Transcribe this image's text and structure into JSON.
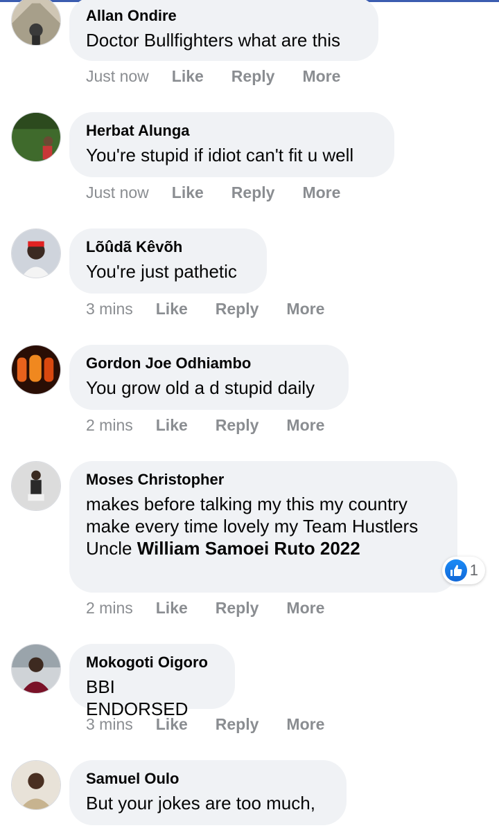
{
  "comments": [
    {
      "author": "Allan Ondire",
      "text": "Doctor Bullfighters what are this",
      "time": "Just now",
      "like": "Like",
      "reply": "Reply",
      "more": "More"
    },
    {
      "author": "Herbat Alunga",
      "text": "You're stupid if idiot can't fit u well",
      "time": "Just now",
      "like": "Like",
      "reply": "Reply",
      "more": "More"
    },
    {
      "author": "Lõûdã Kêvõh",
      "text": "You're just pathetic",
      "time": "3 mins",
      "like": "Like",
      "reply": "Reply",
      "more": "More"
    },
    {
      "author": "Gordon Joe Odhiambo",
      "text": "You grow old a d stupid daily",
      "time": "2 mins",
      "like": "Like",
      "reply": "Reply",
      "more": "More"
    },
    {
      "author": "Moses Christopher",
      "text": "makes before talking my this my country make every time lovely my Team Hustlers Uncle",
      "text_bold": "William Samoei Ruto 2022",
      "time": "2 mins",
      "like": "Like",
      "reply": "Reply",
      "more": "More",
      "reaction_icon": "like-icon",
      "reaction_count": "1"
    },
    {
      "author": "Mokogoti Oigoro",
      "text": "BBI ENDORSED",
      "time": "3 mins",
      "like": "Like",
      "reply": "Reply",
      "more": "More"
    },
    {
      "author": "Samuel Oulo",
      "text": "But your jokes are too much,"
    }
  ],
  "colors": {
    "accent": "#3b5db0",
    "bubble": "#f0f2f5",
    "meta": "#8a8d91",
    "like_blue": "#1877f2"
  }
}
